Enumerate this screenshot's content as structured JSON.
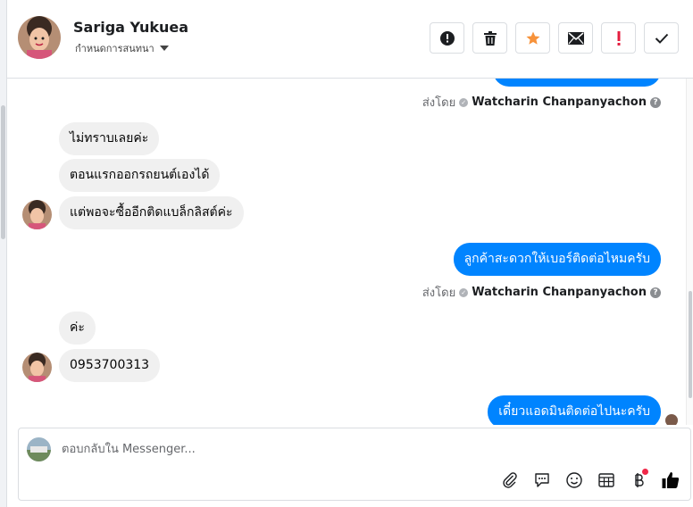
{
  "header": {
    "contact_name": "Sariga Yukuea",
    "subtitle": "กำหนดการสนทนา"
  },
  "actions": [
    {
      "name": "report-button",
      "icon": "exclamation-circle-icon"
    },
    {
      "name": "delete-button",
      "icon": "trash-icon"
    },
    {
      "name": "star-button",
      "icon": "star-icon",
      "color": "#f7923a"
    },
    {
      "name": "mark-unread-button",
      "icon": "envelope-icon"
    },
    {
      "name": "flag-important-button",
      "icon": "exclamation-icon",
      "color": "#e41e3f"
    },
    {
      "name": "done-button",
      "icon": "check-icon"
    }
  ],
  "messages": {
    "sent_by_label": "ส่งโดย",
    "agent_name": "Watcharin Chanpanyachon",
    "in_1": "ไม่ทราบเลยค่ะ",
    "in_2": "ตอนแรกออกรถยนต์เองได้",
    "in_3": "แต่พอจะซื้ออีกติดแบล็กลิสต์ค่ะ",
    "out_1": "ลูกค้าสะดวกให้เบอร์ติดต่อไหมครับ",
    "in_4": "ค่ะ",
    "in_5": "0953700313",
    "out_2": "เดี๋ยวแอดมินติดต่อไปนะครับ"
  },
  "composer": {
    "placeholder": "ตอบกลับใน Messenger...",
    "value": ""
  },
  "colors": {
    "outgoing_bubble": "#0084ff",
    "incoming_bubble": "#f0f0f0",
    "like_icon": "#050505"
  }
}
